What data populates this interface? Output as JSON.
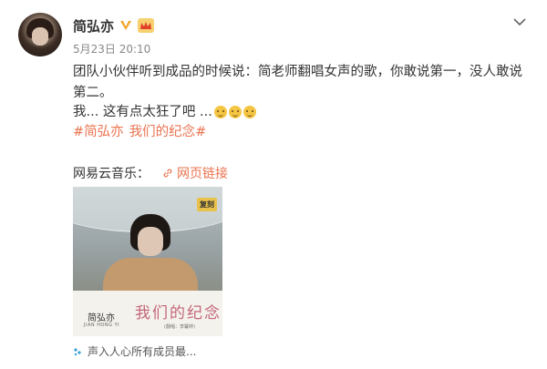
{
  "post": {
    "author": {
      "name": "简弘亦"
    },
    "timestamp": "5月23日 20:10",
    "text": "团队小伙伴听到成品的时候说：简老师翻唱女声的歌，你敢说第一，没人敢说第二。",
    "text_line3": "我... 这有点太狂了吧 ...",
    "hashtags": [
      "#简弘亦",
      "我们的纪念#"
    ]
  },
  "music": {
    "label": "网易云音乐：",
    "link_label": "网页链接",
    "cover": {
      "artist": "简弘亦",
      "artist_en": "JIAN HONG YI",
      "title": "我们的纪念",
      "subtitle": "(翻唱：李馨婷)",
      "badge": "复刻"
    }
  },
  "footer": {
    "text": "声入人心所有成员最..."
  },
  "colors": {
    "accent": "#eb7350",
    "verified": "#f2a42a"
  },
  "icons": [
    "verified-v-icon",
    "crown-icon",
    "more-chevron-icon",
    "smile-emoji-icon",
    "link-icon",
    "sparkle-icon"
  ]
}
